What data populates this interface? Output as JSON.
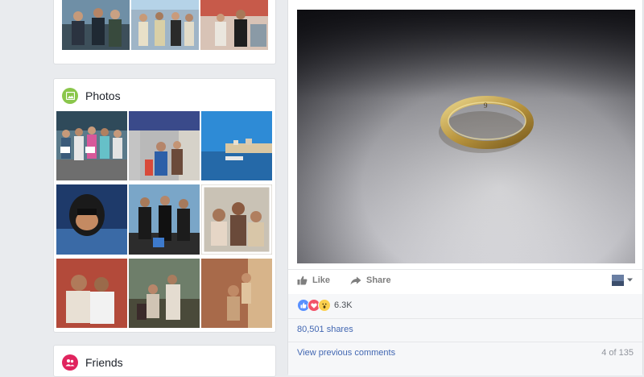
{
  "left_column": {
    "photos_section": {
      "title": "Photos",
      "icon": "photo-icon",
      "icon_color": "#8ac64b"
    },
    "friends_section": {
      "title": "Friends",
      "icon": "friends-icon",
      "icon_color": "#e0245e"
    }
  },
  "post": {
    "actions": {
      "like_label": "Like",
      "share_label": "Share"
    },
    "reactions": {
      "types": [
        "like",
        "love",
        "wow"
      ],
      "count": "6.3K"
    },
    "shares_label": "80,501 shares",
    "comments": {
      "view_previous_label": "View previous comments",
      "count_label": "4 of 135"
    }
  },
  "colors": {
    "link": "#4267b2",
    "page_bg": "#e9ebee",
    "like_blue": "#5890ff",
    "love_red": "#f25268",
    "wow_yellow": "#fcd04e"
  }
}
